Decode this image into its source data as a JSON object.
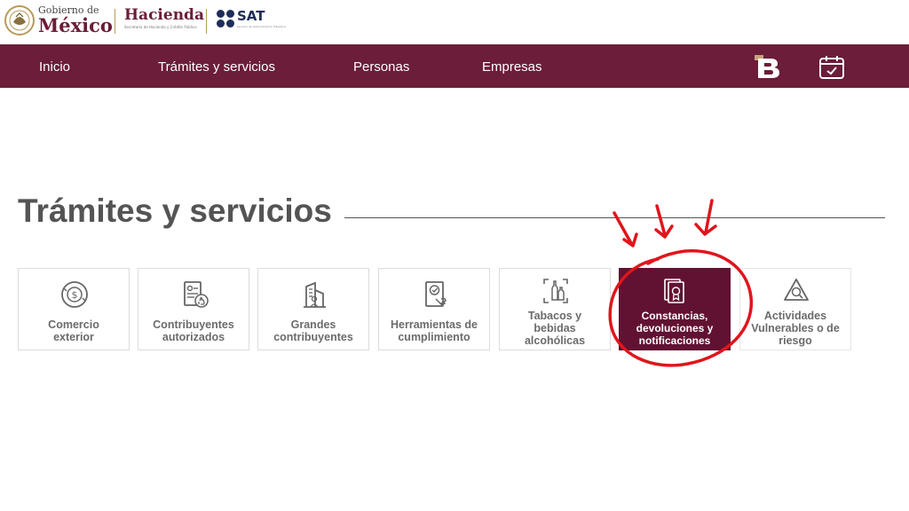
{
  "header": {
    "gobierno_line1": "Gobierno de",
    "gobierno_line2": "México",
    "hacienda_title": "Hacienda",
    "hacienda_subtitle": "Secretaría de Hacienda y Crédito Público",
    "sat_title": "SAT",
    "sat_subtitle": "Servicio de Administración Tributaria"
  },
  "nav": {
    "items": [
      {
        "label": "Inicio"
      },
      {
        "label": "Trámites y servicios"
      },
      {
        "label": "Personas"
      },
      {
        "label": "Empresas"
      }
    ],
    "icons": [
      "b-icon",
      "calendar-check-icon"
    ]
  },
  "main": {
    "title": "Trámites y servicios"
  },
  "cards": [
    {
      "line1": "Comercio",
      "line2": "exterior",
      "line3": "",
      "icon": "dollar-globe-icon"
    },
    {
      "line1": "Contribuyentes",
      "line2": "autorizados",
      "line3": "",
      "icon": "document-thumbs-up-icon"
    },
    {
      "line1": "Grandes",
      "line2": "contribuyentes",
      "line3": "",
      "icon": "building-person-icon"
    },
    {
      "line1": "Herramientas de",
      "line2": "cumplimiento",
      "line3": "",
      "icon": "document-wrench-icon"
    },
    {
      "line1": "Tabacos y",
      "line2": "bebidas",
      "line3": "alcohólicas",
      "icon": "bottles-icon"
    },
    {
      "line1": "Constancias,",
      "line2": "devoluciones y",
      "line3": "notificaciones",
      "icon": "certificates-icon",
      "active": true
    },
    {
      "line1": "Actividades",
      "line2": "Vulnerables o de",
      "line3": "riesgo",
      "icon": "warning-search-icon"
    }
  ],
  "colors": {
    "brand": "#6b1d3a",
    "active_card": "#611232",
    "annotation": "#e0151b",
    "text": "#545454"
  }
}
